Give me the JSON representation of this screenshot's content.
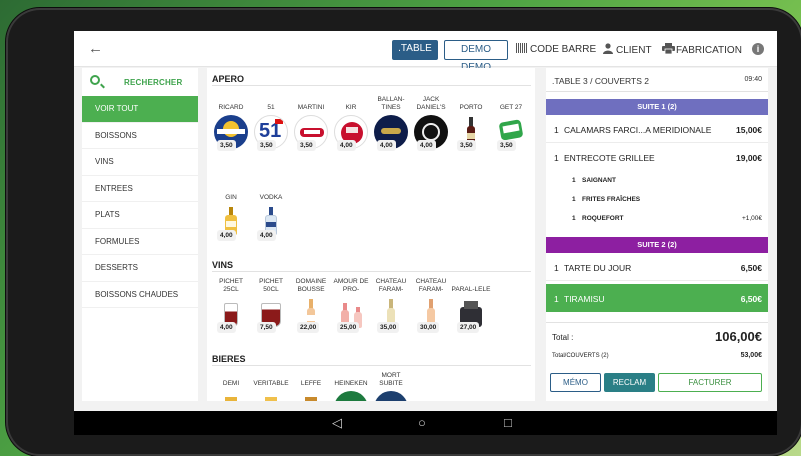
{
  "topbar": {
    "back_icon": "arrow-left-icon",
    "table_btn": ".TABLE",
    "demo_btn": "DEMO DEMO",
    "barcode": "CODE BARRE",
    "client": "CLIENT",
    "fabrication": "FABRICATION",
    "info_glyph": "i"
  },
  "sidebar": {
    "search_label": "RECHERCHER",
    "categories": [
      "VOIR TOUT",
      "BOISSONS",
      "VINS",
      "ENTREES",
      "PLATS",
      "FORMULES",
      "DESSERTS",
      "BOISSONS CHAUDES"
    ]
  },
  "products": {
    "sections": [
      {
        "title": "APERO",
        "items": [
          {
            "name": "RICARD",
            "price": "3,50",
            "icon": "ricard-logo"
          },
          {
            "name": "51",
            "price": "3,50",
            "icon": "51-logo"
          },
          {
            "name": "MARTINI",
            "price": "3,50",
            "icon": "martini-logo"
          },
          {
            "name": "KIR",
            "price": "4,00",
            "icon": "kir-logo"
          },
          {
            "name": "BALLAN-TINES",
            "price": "4,00",
            "icon": "ballantines-logo"
          },
          {
            "name": "JACK DANIEL'S",
            "price": "4,00",
            "icon": "jack-daniels-logo"
          },
          {
            "name": "PORTO",
            "price": "3,50",
            "icon": "porto-bottle"
          },
          {
            "name": "GET 27",
            "price": "3,50",
            "icon": "get27-logo"
          },
          {
            "name": "GIN",
            "price": "4,00",
            "icon": "gin-bottle"
          },
          {
            "name": "VODKA",
            "price": "4,00",
            "icon": "vodka-bottle"
          }
        ]
      },
      {
        "title": "VINS",
        "items": [
          {
            "name": "PICHET 25CL",
            "price": "4,00",
            "icon": "pichet-icon"
          },
          {
            "name": "PICHET 50CL",
            "price": "7,50",
            "icon": "pichet-icon"
          },
          {
            "name": "DOMAINE BOUSSE",
            "price": "22,00",
            "icon": "wine-bottle"
          },
          {
            "name": "AMOUR DE PRO-",
            "price": "25,00",
            "icon": "wine-bottle"
          },
          {
            "name": "CHATEAU FARAM-",
            "price": "35,00",
            "icon": "wine-bottle"
          },
          {
            "name": "CHATEAU FARAM-",
            "price": "30,00",
            "icon": "wine-bottle"
          },
          {
            "name": "PARAL-LELE",
            "price": "27,00",
            "icon": "wine-bottle"
          }
        ]
      },
      {
        "title": "BIERES",
        "items": [
          {
            "name": "DEMI",
            "icon": "beer-glass"
          },
          {
            "name": "VERITABLE",
            "icon": "beer-glass"
          },
          {
            "name": "LEFFE",
            "icon": "beer-glass"
          },
          {
            "name": "HEINEKEN",
            "icon": "beer-logo"
          },
          {
            "name": "MORT SUBITE",
            "icon": "beer-logo"
          }
        ]
      }
    ]
  },
  "ticket": {
    "title": ".TABLE 3 / COUVERTS 2",
    "time": "09:40",
    "suite1": "SUITE 1 (2)",
    "suite2": "SUITE 2 (2)",
    "lines": [
      {
        "qty": "1",
        "name": "CALAMARS FARCI...A MERIDIONALE",
        "amount": "15,00€"
      },
      {
        "qty": "1",
        "name": "ENTRECOTE GRILLEE",
        "amount": "19,00€"
      }
    ],
    "modifiers": [
      {
        "qty": "1",
        "name": "SAIGNANT",
        "amount": ""
      },
      {
        "qty": "1",
        "name": "FRITES FRAÎCHES",
        "amount": ""
      },
      {
        "qty": "1",
        "name": "ROQUEFORT",
        "amount": "+1,00€"
      }
    ],
    "lines2": [
      {
        "qty": "1",
        "name": "TARTE DU JOUR",
        "amount": "6,50€"
      },
      {
        "qty": "1",
        "name": "TIRAMISU",
        "amount": "6,50€"
      }
    ],
    "total_label": "Total :",
    "total_value": "106,00€",
    "per_cover_label": "Total/COUVERTS (2)",
    "per_cover_value": "53,00€",
    "memo": "MÉMO",
    "reclam": "RECLAM",
    "facturer": "FACTURER"
  },
  "navbar": {
    "back": "◁",
    "home": "○",
    "recent": "□"
  }
}
